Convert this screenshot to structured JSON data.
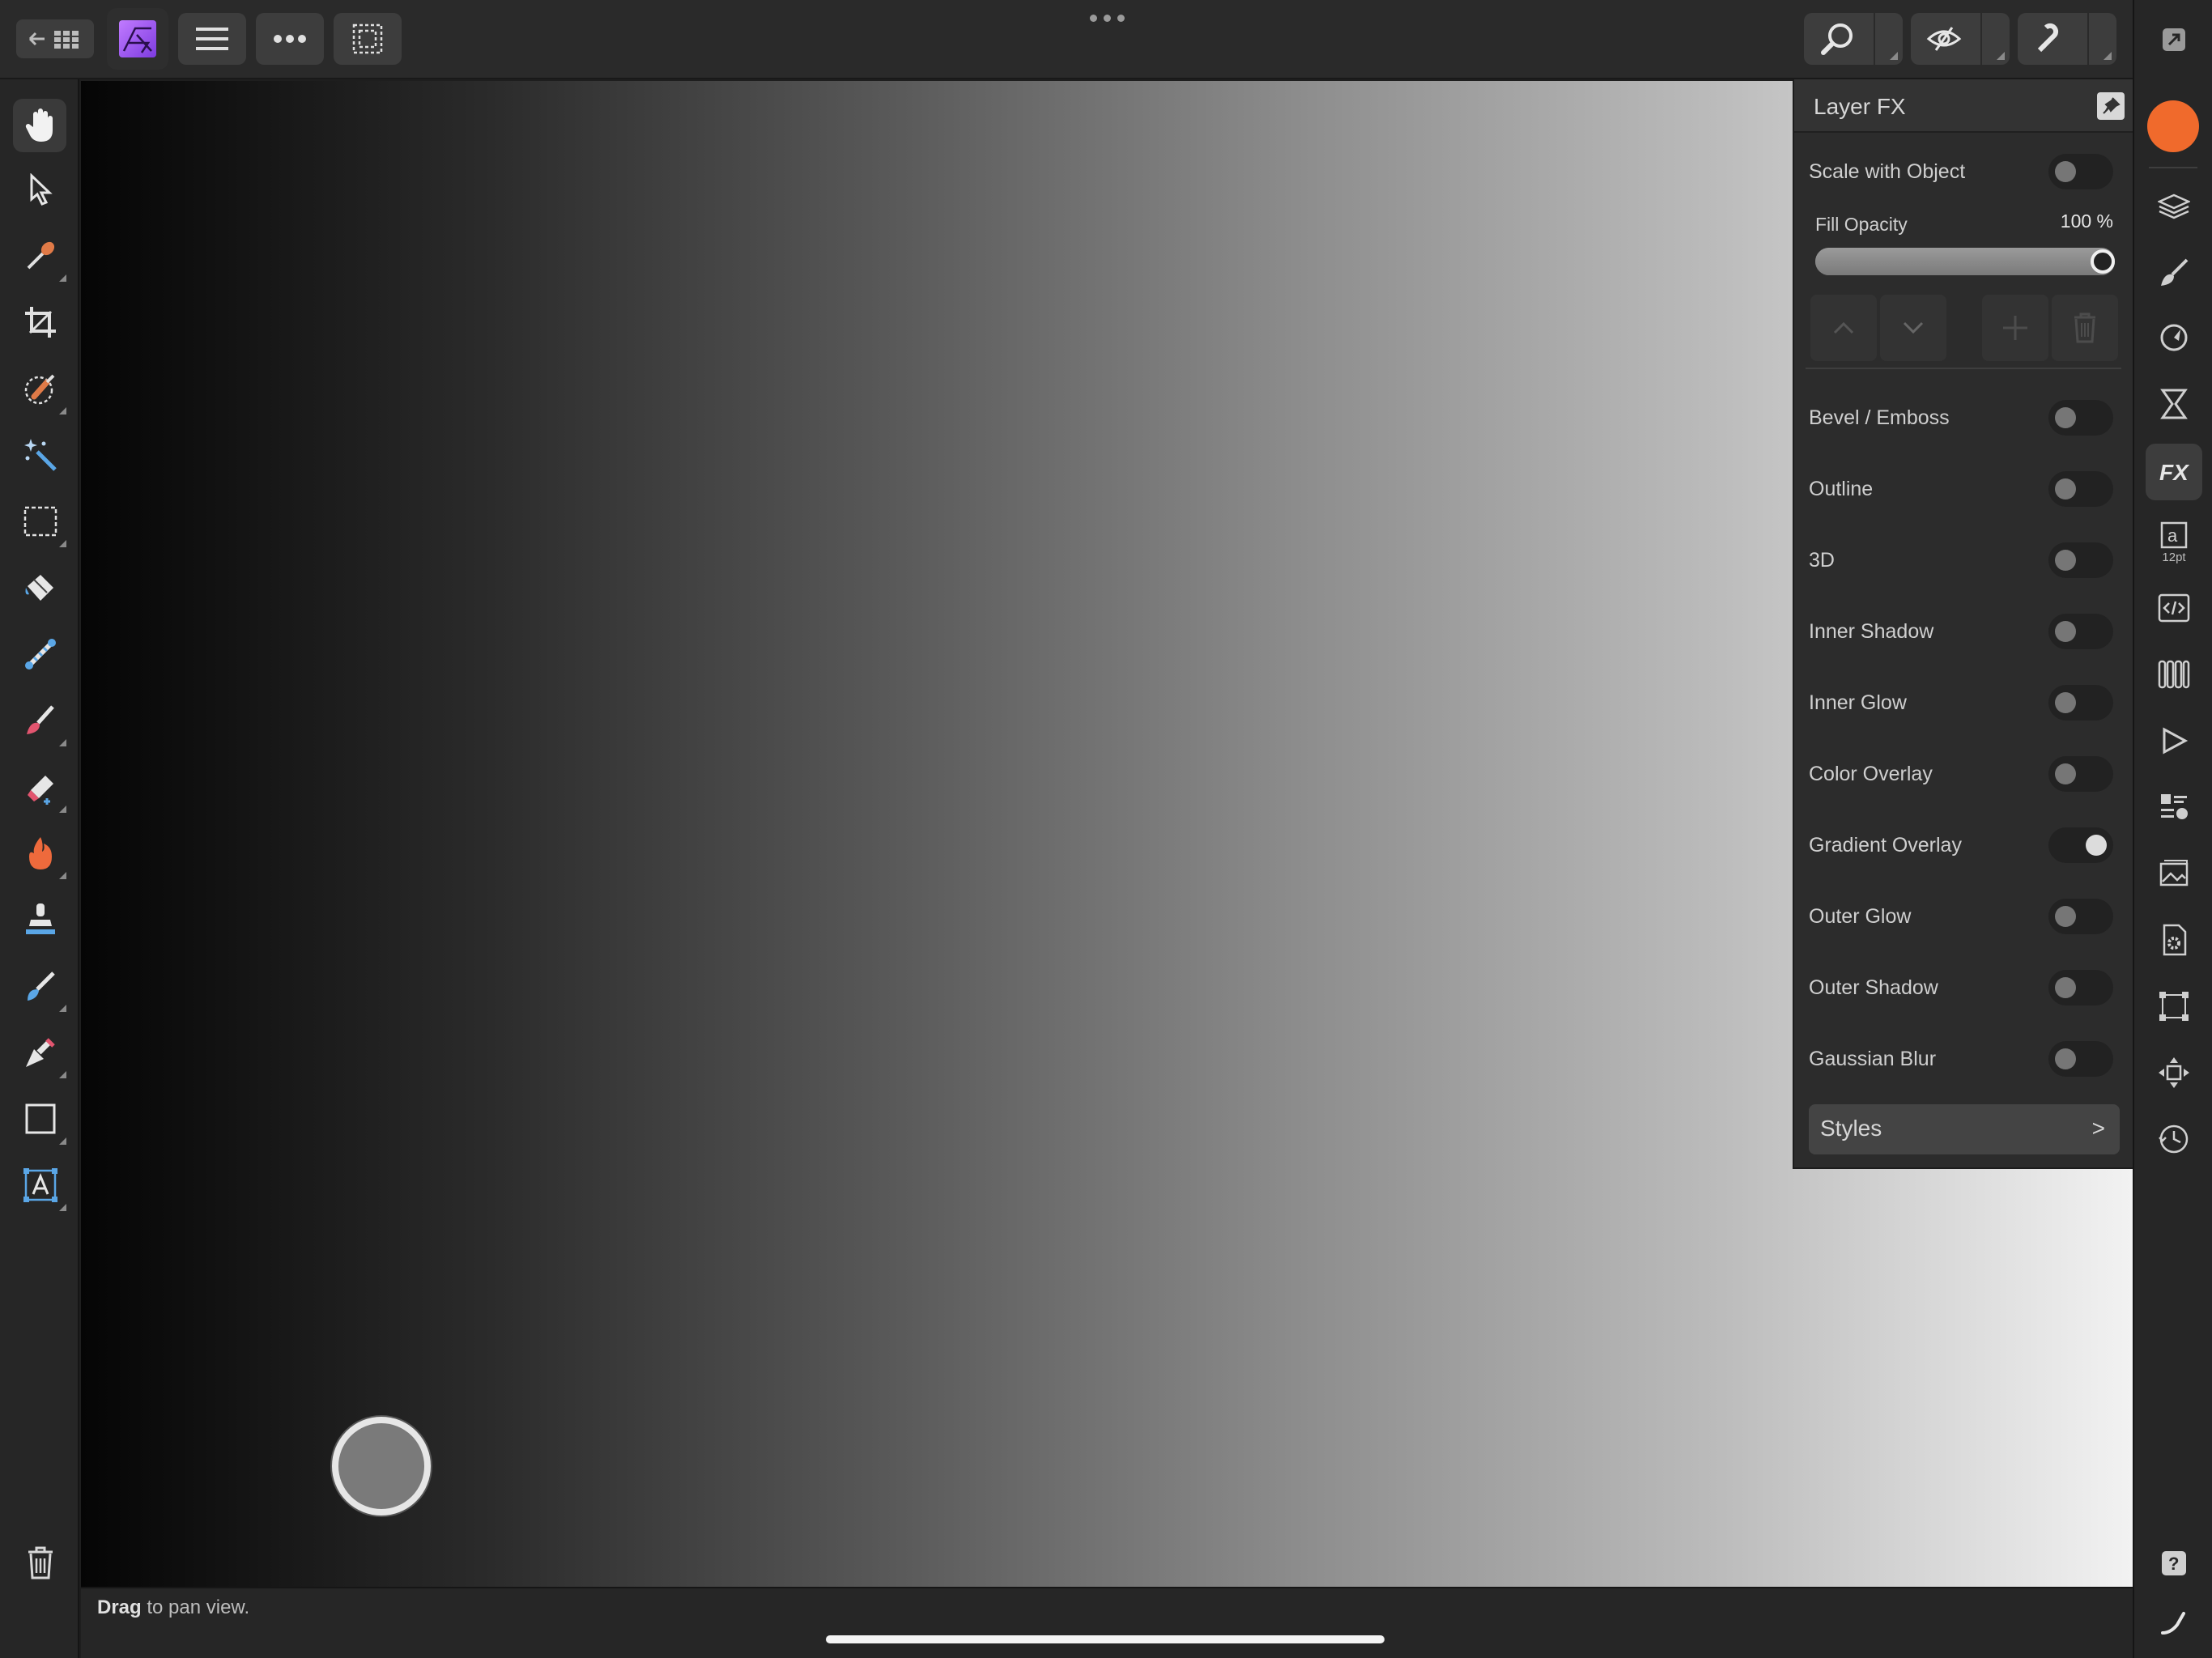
{
  "topbar": {
    "left_buttons": [
      "back-to-gallery-button",
      "affinity-persona-button",
      "menu-button",
      "more-button",
      "selection-button"
    ],
    "context_tools": [
      "zoom-context-button",
      "view-mode-context-button",
      "snapping-context-button"
    ]
  },
  "left_toolbar": {
    "tools": [
      {
        "name": "view-tool",
        "icon": "hand-icon",
        "active": true
      },
      {
        "name": "move-tool",
        "icon": "pointer-icon",
        "active": false
      },
      {
        "name": "color-picker-tool",
        "icon": "eyedropper-icon",
        "active": false
      },
      {
        "name": "crop-tool",
        "icon": "crop-icon",
        "active": false
      },
      {
        "name": "selection-brush-tool",
        "icon": "selection-brush-icon",
        "active": false
      },
      {
        "name": "flood-select-tool",
        "icon": "magic-wand-icon",
        "active": false
      },
      {
        "name": "rectangular-marquee-tool",
        "icon": "marquee-icon",
        "active": false
      },
      {
        "name": "flood-fill-tool",
        "icon": "paint-bucket-icon",
        "active": false
      },
      {
        "name": "gradient-tool",
        "icon": "gradient-icon",
        "active": false
      },
      {
        "name": "paint-brush-tool",
        "icon": "paint-brush-icon",
        "active": false
      },
      {
        "name": "erase-brush-tool",
        "icon": "eraser-icon",
        "active": false
      },
      {
        "name": "dodge-brush-tool",
        "icon": "flame-icon",
        "active": false
      },
      {
        "name": "clone-brush-tool",
        "icon": "stamp-icon",
        "active": false
      },
      {
        "name": "smudge-brush-tool",
        "icon": "smudge-icon",
        "active": false
      },
      {
        "name": "pen-tool",
        "icon": "pen-nib-icon",
        "active": false
      },
      {
        "name": "rectangle-tool",
        "icon": "rectangle-icon",
        "active": false
      },
      {
        "name": "artistic-text-tool",
        "icon": "text-tool-icon",
        "active": false
      }
    ],
    "trash_icon": "trash-icon"
  },
  "status": {
    "bold": "Drag",
    "rest": " to pan view."
  },
  "studio": {
    "text_size_label": "12pt",
    "primary_color": "#f06a2c"
  },
  "layer_fx": {
    "title": "Layer FX",
    "scale_with_object": {
      "label": "Scale with Object",
      "on": false
    },
    "fill_opacity": {
      "label": "Fill Opacity",
      "value_text": "100 %",
      "value": 1.0
    },
    "effects": [
      {
        "label": "Bevel / Emboss",
        "on": false
      },
      {
        "label": "Outline",
        "on": false
      },
      {
        "label": "3D",
        "on": false
      },
      {
        "label": "Inner Shadow",
        "on": false
      },
      {
        "label": "Inner Glow",
        "on": false
      },
      {
        "label": "Color Overlay",
        "on": false
      },
      {
        "label": "Gradient Overlay",
        "on": true
      },
      {
        "label": "Outer Glow",
        "on": false
      },
      {
        "label": "Outer Shadow",
        "on": false
      },
      {
        "label": "Gaussian Blur",
        "on": false
      }
    ],
    "styles_label": "Styles",
    "styles_chevron": ">"
  }
}
